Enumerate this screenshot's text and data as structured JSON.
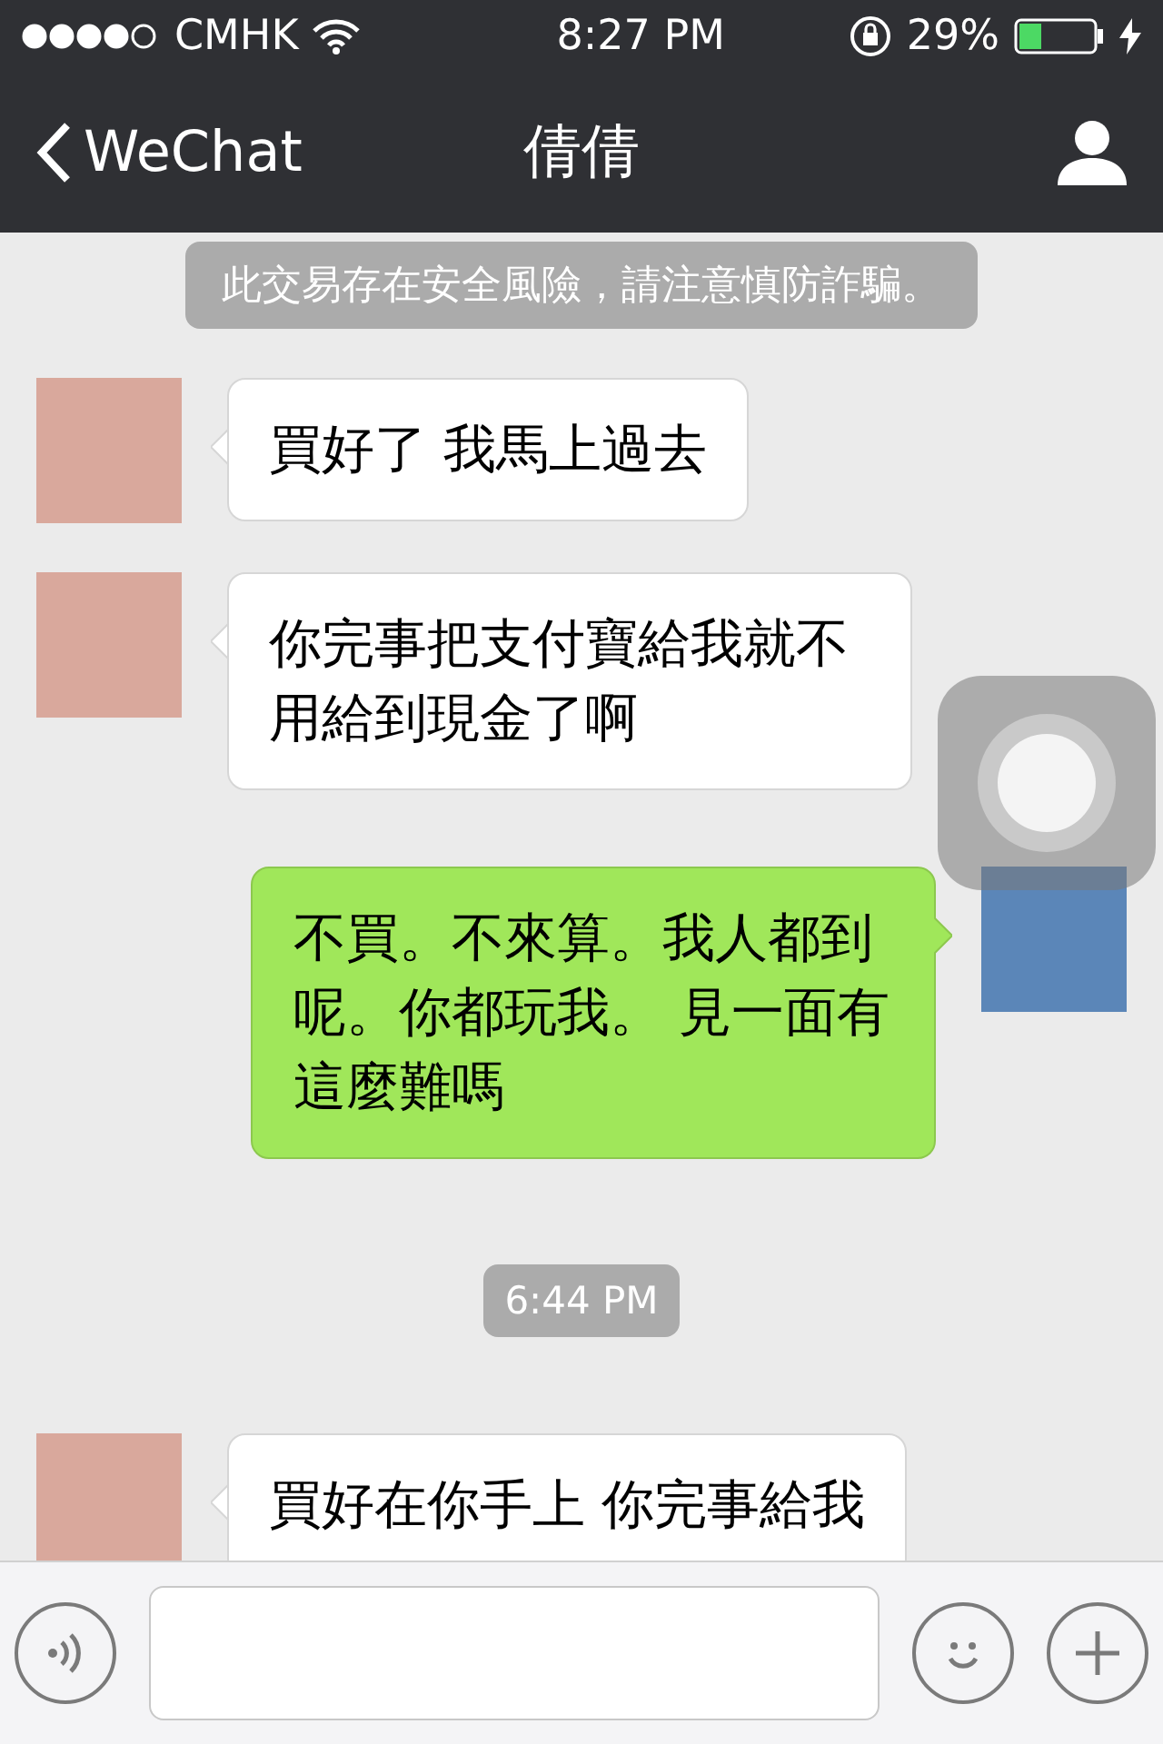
{
  "status_bar": {
    "carrier": "CMHK",
    "time": "8:27 PM",
    "battery": "29%"
  },
  "nav": {
    "back": "WeChat",
    "title": "倩倩"
  },
  "chat": [
    {
      "kind": "notice",
      "text": "此交易存在安全風險，請注意慎防詐騙。"
    },
    {
      "kind": "incoming",
      "text": "買好了 我馬上過去"
    },
    {
      "kind": "incoming",
      "text": "你完事把支付寶給我就不用給到現金了啊"
    },
    {
      "kind": "outgoing",
      "text": "不買。不來算。我人都到呢。你都玩我。 見一面有這麼難嗎"
    },
    {
      "kind": "time",
      "text": "6:44 PM"
    },
    {
      "kind": "incoming",
      "text": "買好在你手上 你完事給我"
    }
  ]
}
